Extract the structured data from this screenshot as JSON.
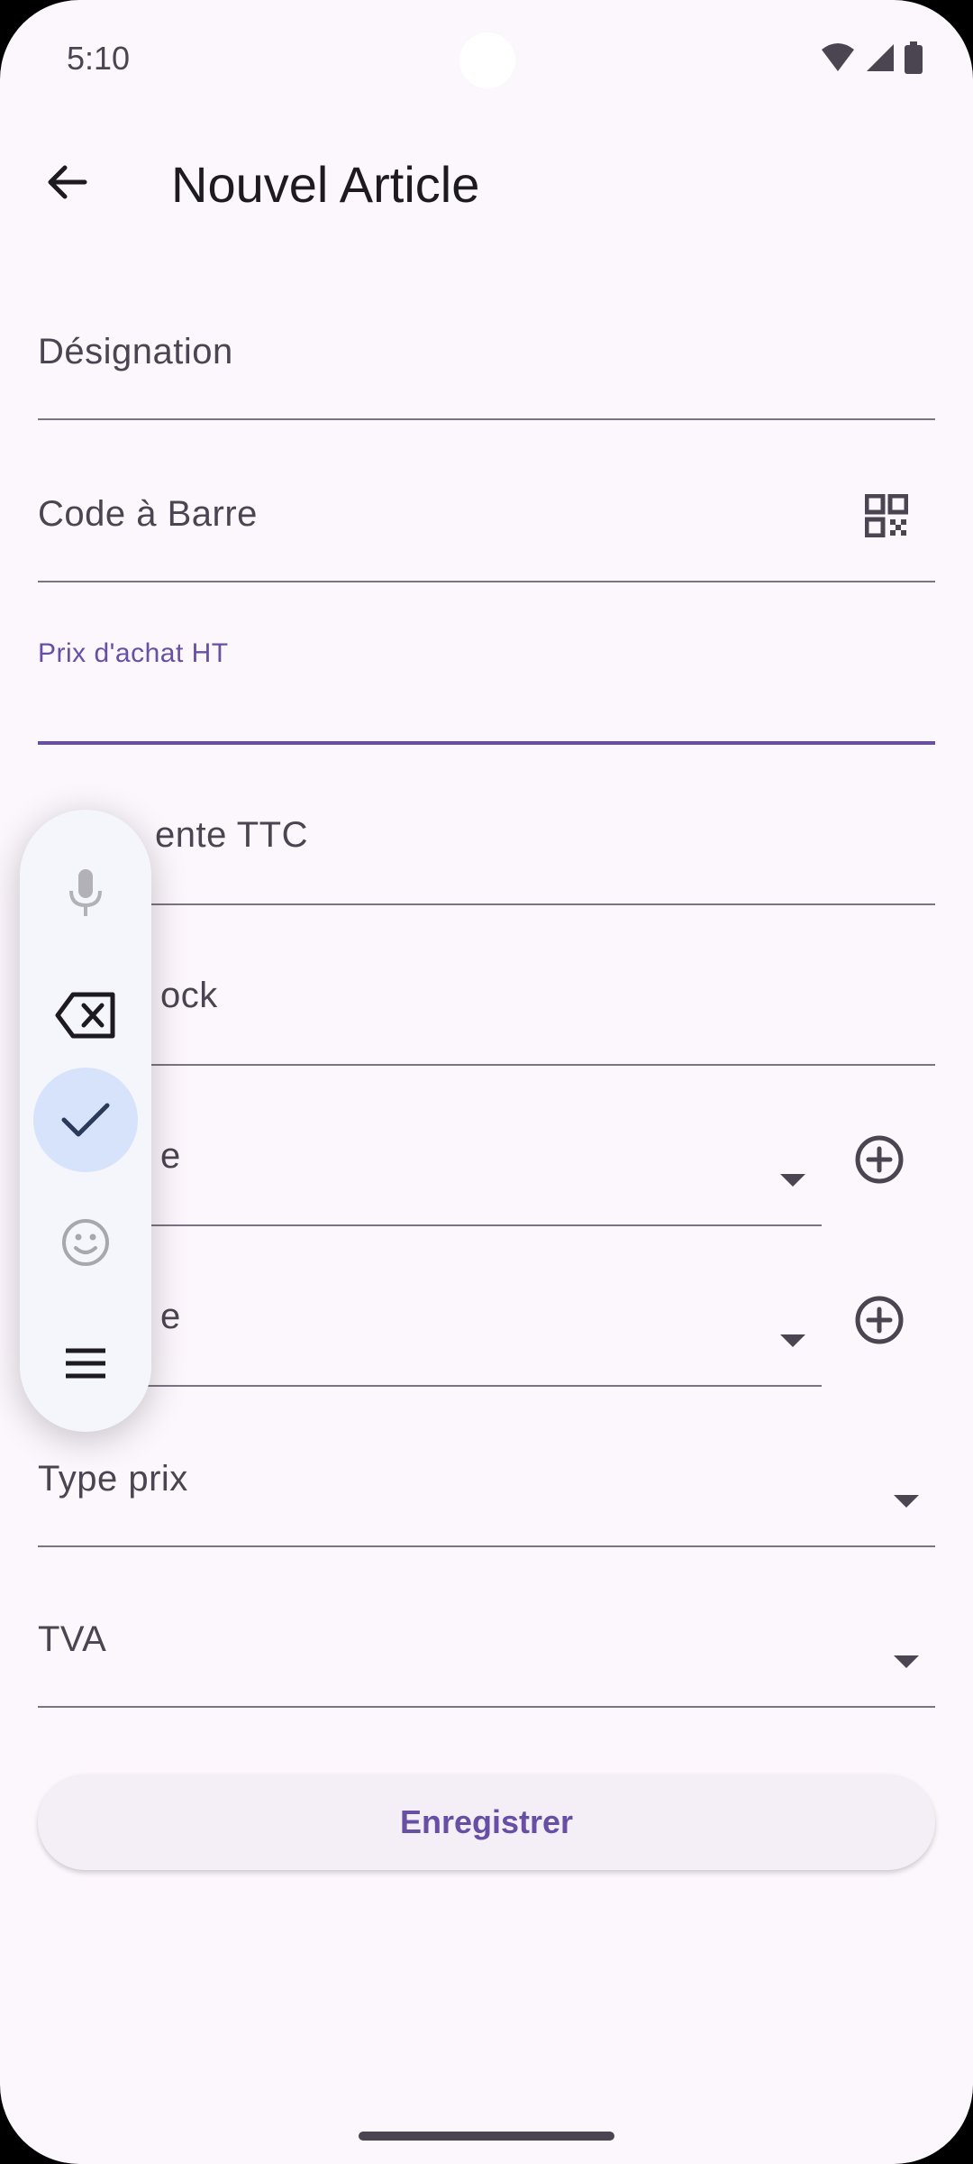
{
  "status_bar": {
    "time": "5:10"
  },
  "appbar": {
    "title": "Nouvel Article",
    "back_icon": "arrow-back-icon"
  },
  "form": {
    "designation": {
      "label": "Désignation"
    },
    "barcode": {
      "label": "Code à Barre",
      "icon": "qr-code-icon"
    },
    "purchase_price": {
      "label": "Prix d'achat HT",
      "value": ""
    },
    "sale_price": {
      "label": "Prix vente TTC",
      "visible_text": "ente TTC"
    },
    "stock": {
      "label": "Stock",
      "visible_text": "ock"
    },
    "dropdown1": {
      "visible_text": "e"
    },
    "dropdown2": {
      "visible_text": "e"
    },
    "price_type": {
      "label": "Type prix"
    },
    "tva": {
      "label": "TVA"
    },
    "save_button": "Enregistrer"
  },
  "keyboard_toolbar": {
    "items": [
      "mic-icon",
      "backspace-icon",
      "check-icon",
      "emoji-icon",
      "menu-icon"
    ],
    "active": "check-icon"
  },
  "colors": {
    "accent": "#6750a4",
    "background": "#fcf6fd",
    "toolbar_active": "#d6e3fb"
  }
}
